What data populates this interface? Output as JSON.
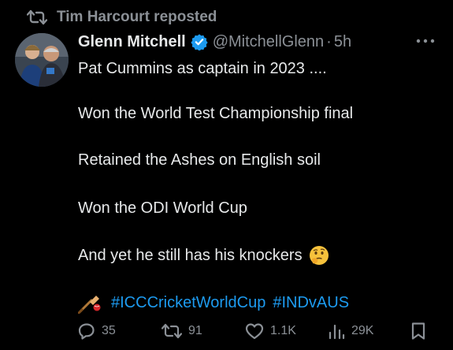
{
  "repost": {
    "text": "Tim Harcourt reposted",
    "icon": "repost-icon"
  },
  "author": {
    "display_name": "Glenn Mitchell",
    "handle": "@MitchellGlenn",
    "separator": "·",
    "time": "5h",
    "verified_color": "#1d9bf0"
  },
  "tweet": {
    "lines": [
      "Pat Cummins as captain in 2023 ....",
      "Won the World Test Championship final",
      "Retained the Ashes on English soil",
      "Won the ODI World Cup",
      "And yet he still has his knockers"
    ],
    "emoji": "thinking-face-icon",
    "cricket_emoji": "cricket-bat-ball-icon",
    "hashtags": [
      "#ICCCricketWorldCup",
      "#INDvAUS"
    ]
  },
  "actions": {
    "replies": "35",
    "reposts": "91",
    "likes": "1.1K",
    "views": "29K"
  },
  "colors": {
    "background": "#000000",
    "text": "#e7e9ea",
    "muted": "#8b9096",
    "link": "#1d9bf0"
  }
}
